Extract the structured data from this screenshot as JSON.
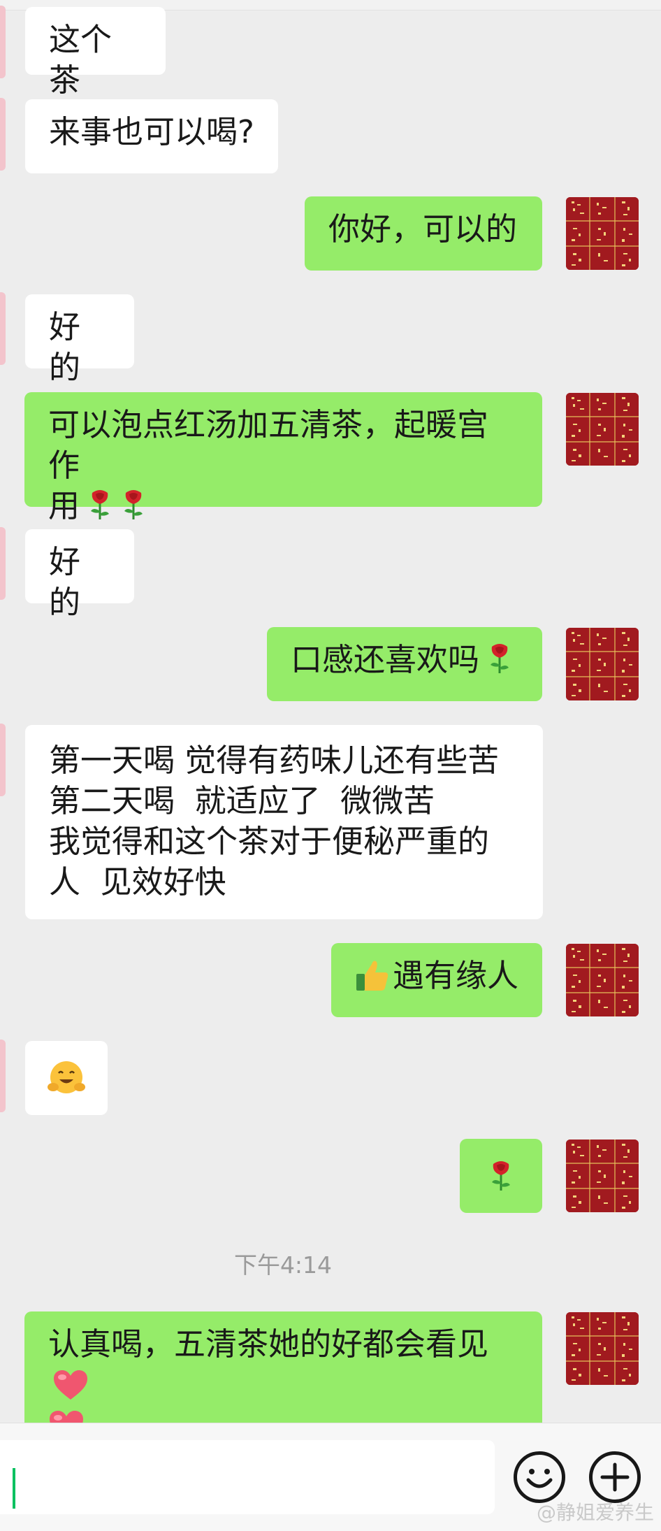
{
  "messages": [
    {
      "side": "in",
      "text": "这个茶"
    },
    {
      "side": "in",
      "text": "来事也可以喝?"
    },
    {
      "side": "out",
      "text": "你好，可以的"
    },
    {
      "side": "in",
      "text": "好的"
    },
    {
      "side": "out",
      "text": "可以泡点红汤加五清茶，起暖宫作",
      "text2": "用",
      "emoji": [
        "rose-emoji",
        "rose-emoji"
      ]
    },
    {
      "side": "in",
      "text": "好的"
    },
    {
      "side": "out",
      "text": "口感还喜欢吗",
      "emoji": [
        "rose-emoji"
      ]
    },
    {
      "side": "in",
      "lines": [
        "第一天喝 觉得有药味儿还有些苦",
        "第二天喝  就适应了  微微苦",
        "我觉得和这个茶对于便秘严重的",
        "人  见效好快"
      ]
    },
    {
      "side": "out",
      "text": "遇有缘人",
      "emoji": [
        "thumbs-up-emoji"
      ]
    },
    {
      "side": "in",
      "emoji": [
        "hug-face-emoji"
      ]
    },
    {
      "side": "out",
      "emoji": [
        "rose-emoji"
      ]
    },
    {
      "side": "out",
      "text": "认真喝，五清茶她的好都会看见",
      "emoji": [
        "heart-emoji",
        "heart-emoji"
      ]
    }
  ],
  "timestamp": "下午4:14",
  "input": {
    "value": "",
    "emoji_button_icon": "smiley-icon",
    "plus_button_icon": "plus-icon"
  },
  "watermark": "@静姐爱养生",
  "colors": {
    "background": "#ededed",
    "outgoing": "#95ec69",
    "incoming": "#ffffff",
    "avatar": "#a11a1f",
    "caret": "#07c160"
  }
}
